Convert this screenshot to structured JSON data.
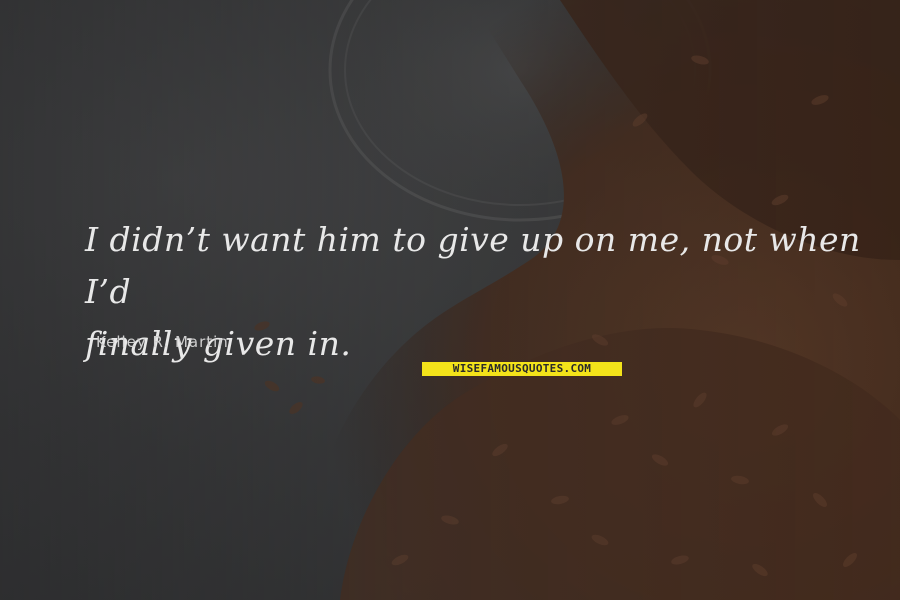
{
  "quote": {
    "line1": "I didn’t want him to give up on me, not when I’d",
    "line2": "finally given in."
  },
  "author": "Kelley R. Martin",
  "watermark": "WISEFAMOUSQUOTES.COM",
  "colors": {
    "background": "#3a3b3c",
    "text": "#e8e8e8",
    "watermark_bg": "#f3e31a",
    "seed": "#5a3a26"
  }
}
